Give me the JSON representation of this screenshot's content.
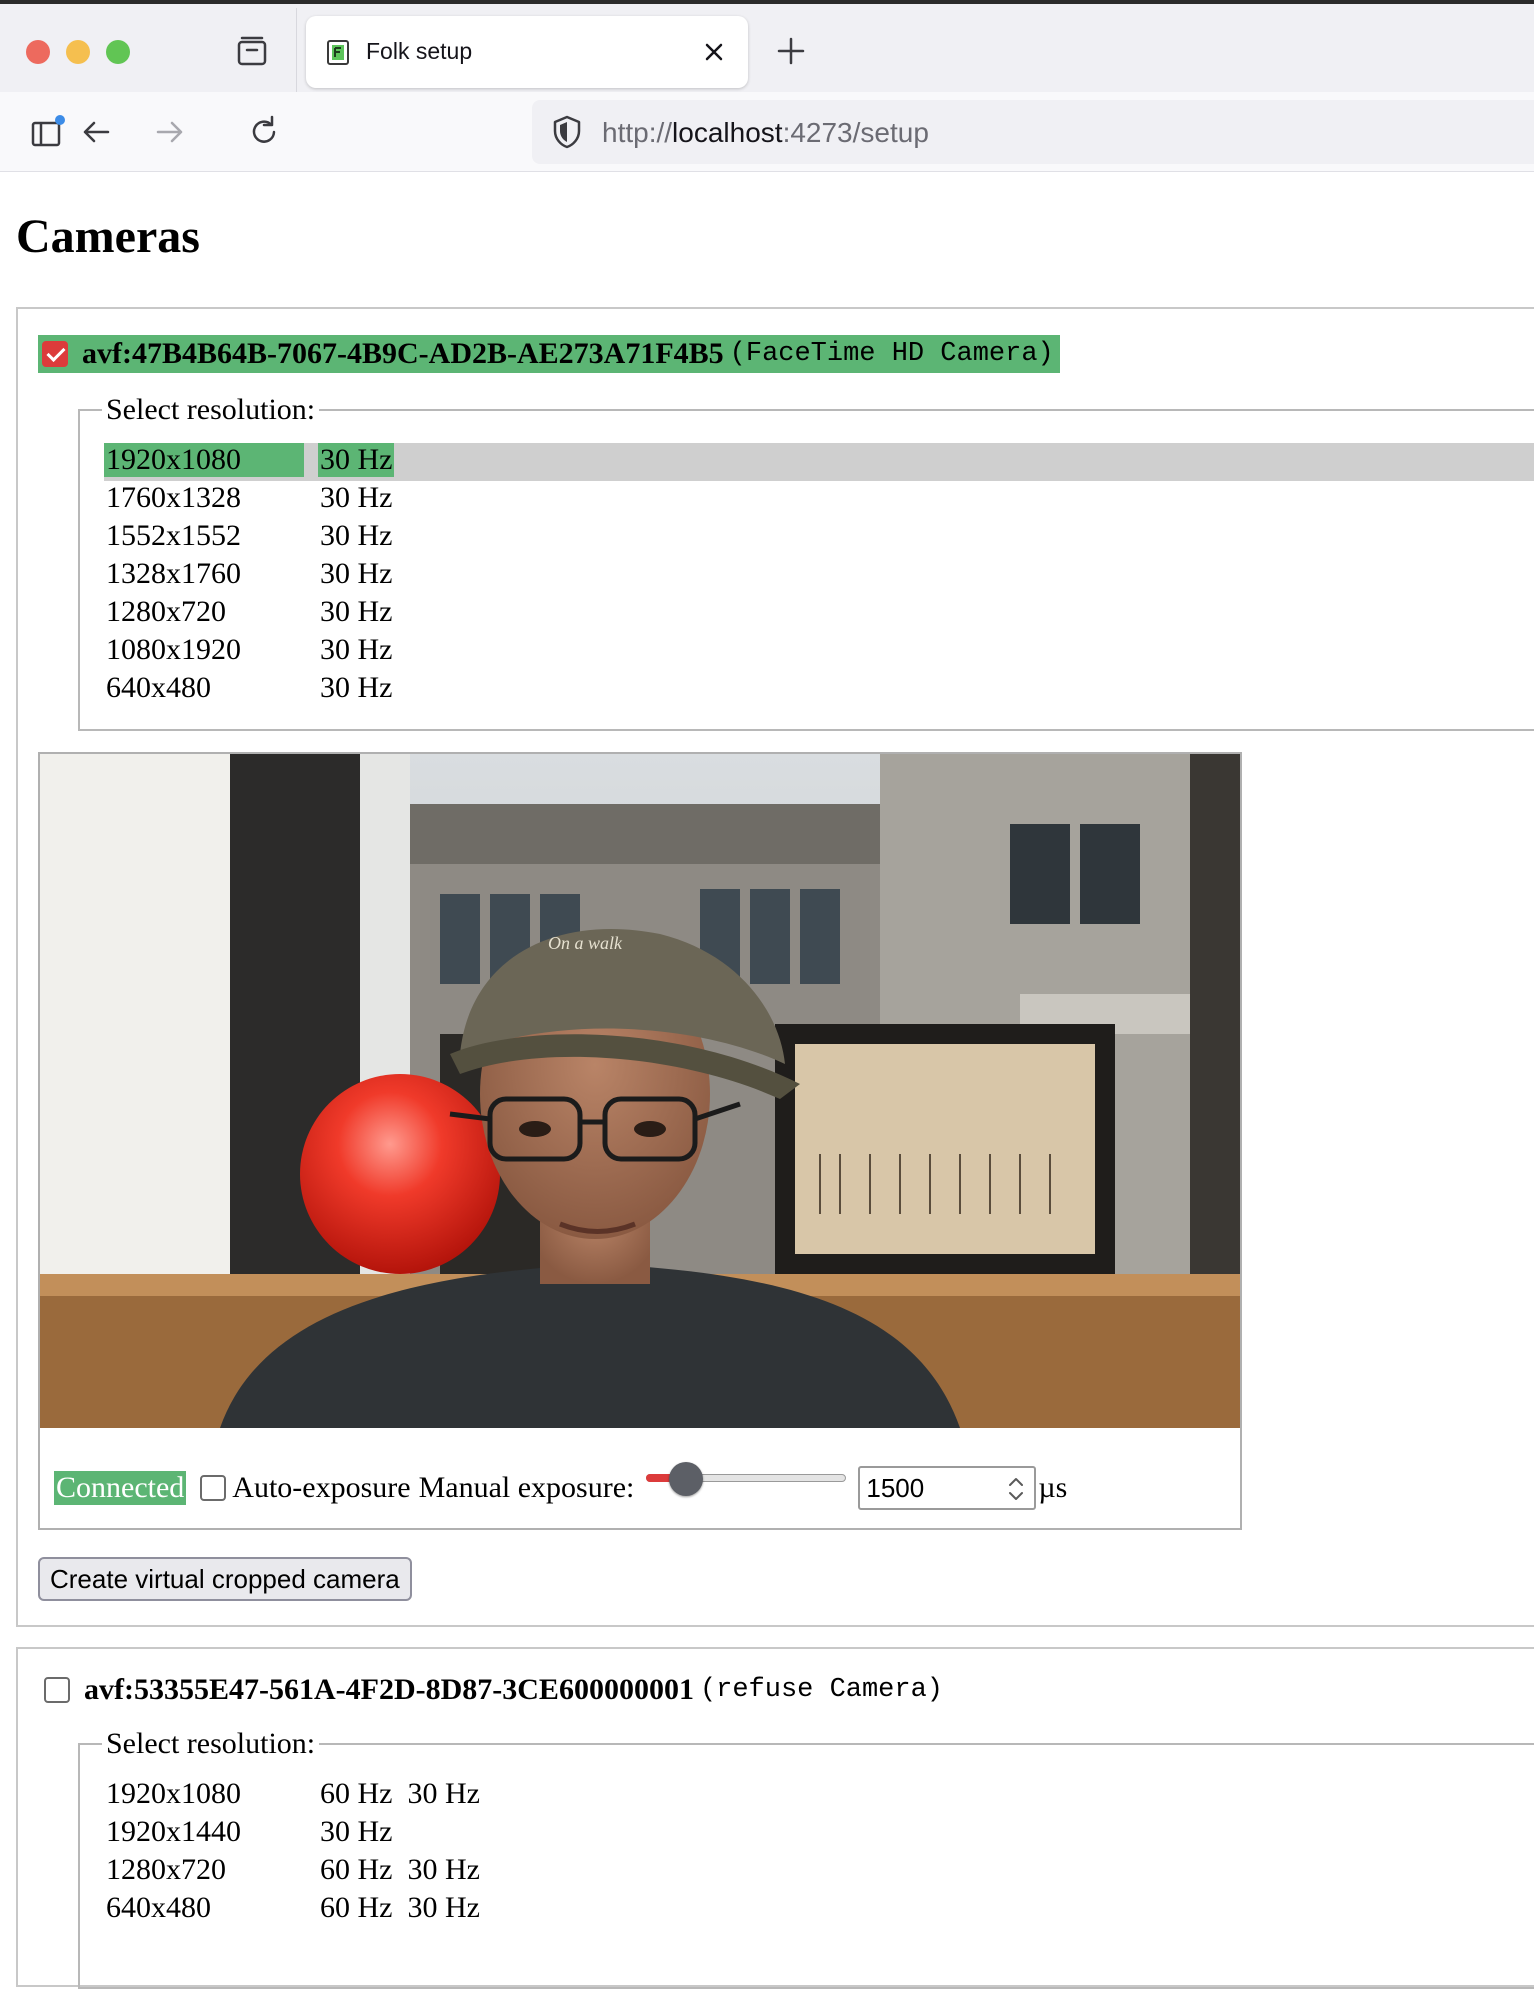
{
  "browser": {
    "tab_title": "Folk setup",
    "url_scheme": "http://",
    "url_host": "localhost",
    "url_rest": ":4273/setup"
  },
  "page": {
    "title": "Cameras"
  },
  "cameras": [
    {
      "checked": true,
      "id": "avf:47B4B64B-7067-4B9C-AD2B-AE273A71F4B5",
      "name": "(FaceTime HD Camera)",
      "legend": "Select resolution:",
      "resolutions": [
        {
          "size": "1920x1080",
          "rates": "30 Hz",
          "selected": true
        },
        {
          "size": "1760x1328",
          "rates": "30 Hz"
        },
        {
          "size": "1552x1552",
          "rates": "30 Hz"
        },
        {
          "size": "1328x1760",
          "rates": "30 Hz"
        },
        {
          "size": "1280x720",
          "rates": "30 Hz"
        },
        {
          "size": "1080x1920",
          "rates": "30 Hz"
        },
        {
          "size": "640x480",
          "rates": "30 Hz"
        }
      ],
      "status": "Connected",
      "auto_exposure_label": "Auto-exposure",
      "manual_exposure_label": "Manual exposure:",
      "exposure_value": "1500",
      "exposure_unit": "µs",
      "exposure_slider_fraction": 0.2,
      "create_button": "Create virtual cropped camera",
      "preview_text": "On a walk"
    },
    {
      "checked": false,
      "id": "avf:53355E47-561A-4F2D-8D87-3CE600000001",
      "name": "(refuse Camera)",
      "legend": "Select resolution:",
      "resolutions": [
        {
          "size": "1920x1080",
          "rates": "60 Hz  30 Hz"
        },
        {
          "size": "1920x1440",
          "rates": "30 Hz"
        },
        {
          "size": "1280x720",
          "rates": "60 Hz  30 Hz"
        },
        {
          "size": "640x480",
          "rates": "60 Hz  30 Hz"
        }
      ]
    }
  ],
  "colors": {
    "active_green": "#5cb574",
    "checkbox_red": "#dc3b3b",
    "selected_row_gray": "#cfcfcf"
  }
}
